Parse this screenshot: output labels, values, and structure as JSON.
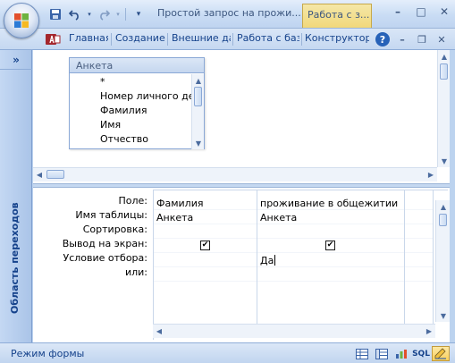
{
  "window": {
    "title": "Простой запрос на прожи...",
    "context_tab": "Работа с з...",
    "controls": [
      "minimize-icon",
      "maximize-icon",
      "close-icon"
    ]
  },
  "quick_access": {
    "items": [
      "save-icon",
      "undo-icon",
      "redo-icon",
      "customize-icon"
    ]
  },
  "ribbon": {
    "tabs": [
      "Главная",
      "Создание",
      "Внешние да",
      "Работа с баз",
      "Конструктор"
    ],
    "help": "?",
    "mdi_controls": [
      "minimize-icon",
      "restore-icon",
      "close-icon"
    ]
  },
  "nav_pane": {
    "toggle": "»",
    "label": "Область переходов"
  },
  "table_box": {
    "title": "Анкета",
    "fields": [
      "*",
      "Номер личного де",
      "Фамилия",
      "Имя",
      "Отчество"
    ]
  },
  "design_grid": {
    "row_labels": [
      "Поле:",
      "Имя таблицы:",
      "Сортировка:",
      "Вывод на экран:",
      "Условие отбора:",
      "или:"
    ],
    "columns": [
      {
        "field": "Фамилия",
        "table": "Анкета",
        "sort": "",
        "show": true,
        "criteria": "",
        "or": ""
      },
      {
        "field": "проживание в общежитии",
        "table": "Анкета",
        "sort": "",
        "show": true,
        "criteria": "Да",
        "or": ""
      },
      {
        "field": "",
        "table": "",
        "sort": "",
        "show": false,
        "criteria": "",
        "or": ""
      }
    ]
  },
  "status_bar": {
    "text": "Режим формы",
    "view_buttons": [
      "datasheet-view-icon",
      "pivot-table-icon",
      "pivot-chart-icon",
      "SQL",
      "design-view-icon"
    ],
    "active_view": "design-view-icon"
  },
  "colors": {
    "ribbon_text": "#15428b",
    "frame": "#bcd3ef",
    "active_view": "#f8cf5c"
  }
}
